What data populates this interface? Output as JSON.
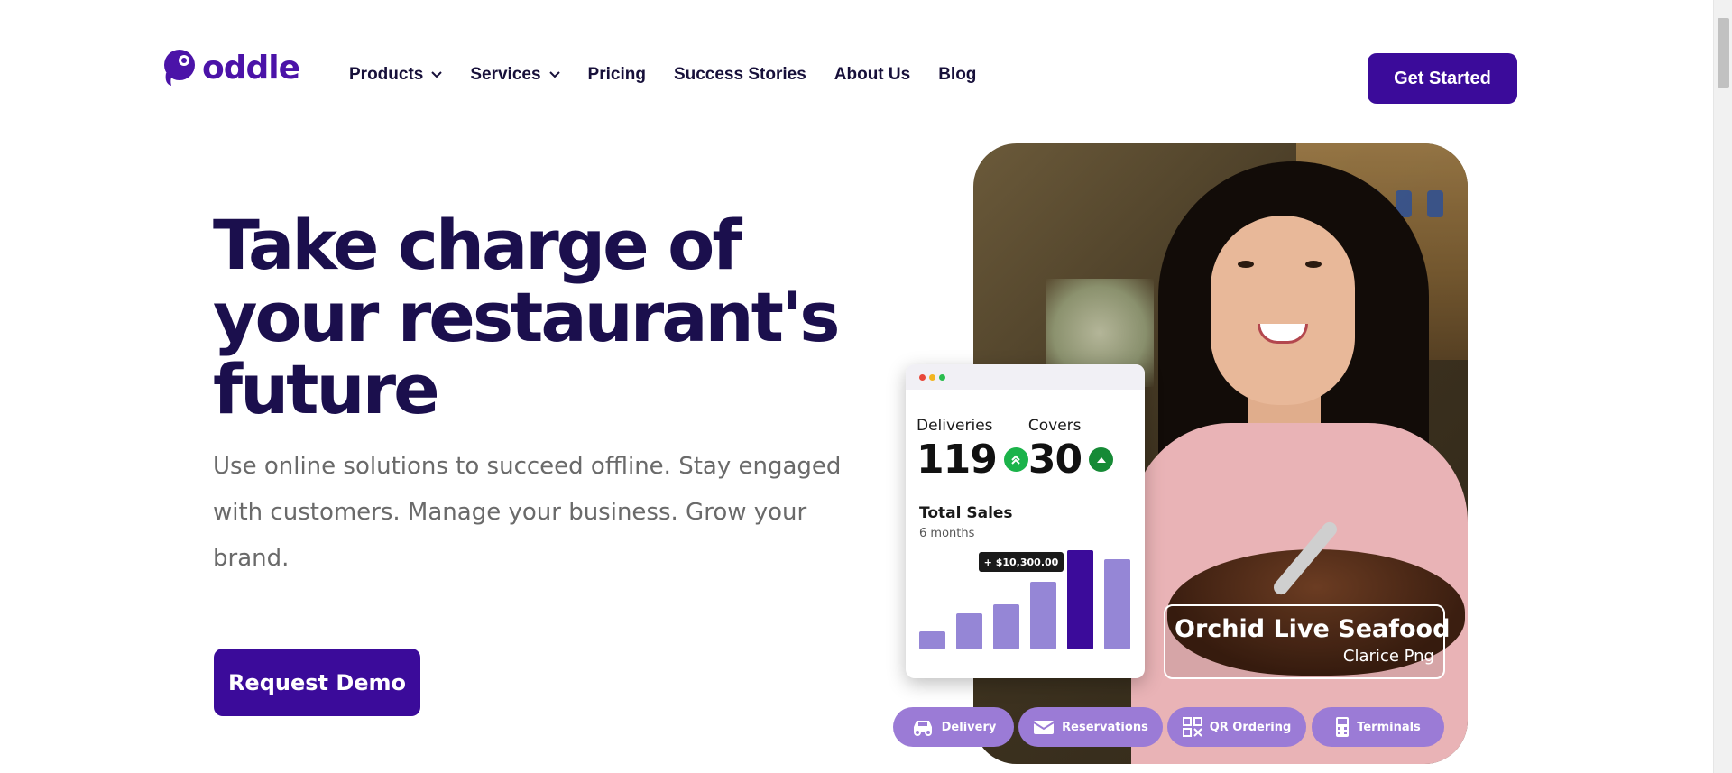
{
  "header": {
    "logo_text": "oddle",
    "nav": [
      {
        "label": "Products",
        "has_dropdown": true
      },
      {
        "label": "Services",
        "has_dropdown": true
      },
      {
        "label": "Pricing",
        "has_dropdown": false
      },
      {
        "label": "Success Stories",
        "has_dropdown": false
      },
      {
        "label": "About Us",
        "has_dropdown": false
      },
      {
        "label": "Blog",
        "has_dropdown": false
      }
    ],
    "cta_label": "Get Started"
  },
  "hero": {
    "title_lines": [
      "Take charge of",
      "your restaurant's",
      "future"
    ],
    "subtitle": "Use online solutions to succeed offline. Stay engaged with customers. Manage your business. Grow your brand.",
    "cta_label": "Request Demo"
  },
  "dashboard": {
    "deliveries_label": "Deliveries",
    "deliveries_value": "119",
    "covers_label": "Covers",
    "covers_value": "30",
    "sales_title": "Total Sales",
    "sales_subtitle": "6 months",
    "tooltip": "+ $10,300.00",
    "bar_values": [
      2,
      4,
      5,
      7.5,
      11,
      10
    ],
    "highlight_index": 4
  },
  "testimonial": {
    "restaurant": "Orchid Live Seafood",
    "person": "Clarice Png"
  },
  "features": [
    {
      "label": "Delivery",
      "icon": "car-icon"
    },
    {
      "label": "Reservations",
      "icon": "envelope-icon"
    },
    {
      "label": "QR Ordering",
      "icon": "qr-code-icon"
    },
    {
      "label": "Terminals",
      "icon": "terminal-icon"
    }
  ],
  "colors": {
    "brand": "#3b0b9a",
    "logo": "#4b13a8",
    "heading": "#1b0f4d",
    "pill": "#9b7bd6",
    "bar": "#9586d6",
    "bar_highlight": "#3b0b9a",
    "up_badge": "#1bb34a"
  }
}
